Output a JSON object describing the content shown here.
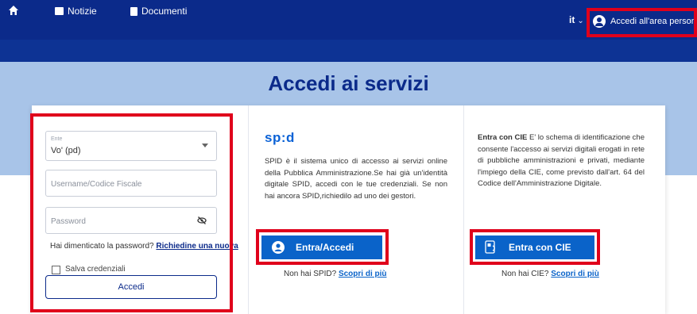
{
  "header": {
    "language": "it",
    "account_label": "Accedi all'area personale"
  },
  "nav": {
    "items": [
      {
        "label": "Notizie"
      },
      {
        "label": "Documenti"
      }
    ]
  },
  "hero": {
    "title": "Accedi ai servizi"
  },
  "login_form": {
    "ente_label": "Ente",
    "ente_value": "Vo' (pd)",
    "username_placeholder": "Username/Codice Fiscale",
    "password_placeholder": "Password",
    "forgot_text": "Hai dimenticato la password?",
    "forgot_link": "Richiedine una nuova",
    "remember_label": "Salva credenziali",
    "submit_label": "Accedi"
  },
  "spid": {
    "logo": "sp:d",
    "description": "SPID è il sistema unico di accesso ai servizi online della Pubblica Amministrazione.Se hai già un'identità digitale SPID, accedi con le tue credenziali. Se non hai ancora SPID,richiedilo ad uno dei gestori.",
    "button_label": "Entra/Accedi",
    "note_text": "Non hai SPID?",
    "note_link": "Scopri di più"
  },
  "cie": {
    "desc_bold": "Entra con CIE",
    "description": " E' lo schema di identificazione che consente l'accesso ai servizi digitali erogati in rete di pubbliche amministrazioni e privati, mediante l'impiego della CIE, come previsto dall'art. 64 del Codice dell'Amministrazione Digitale.",
    "button_label": "Entra con CIE",
    "note_text": "Non hai CIE?",
    "note_link": "Scopri di più"
  },
  "colors": {
    "topbar": "#0b2a8a",
    "navbar": "#0d3394",
    "hero": "#a8c4e8",
    "button_blue": "#0a63c9",
    "highlight_red": "#e0001b"
  }
}
